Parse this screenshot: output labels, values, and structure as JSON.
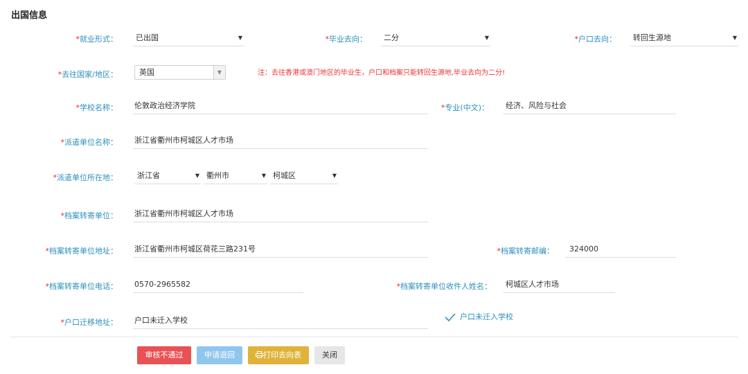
{
  "section_title": "出国信息",
  "fields": {
    "employment_form": {
      "label": "*就业形式：",
      "value": "已出国"
    },
    "graduation_destination": {
      "label": "*毕业去向：",
      "value": "二分"
    },
    "hukou_destination": {
      "label": "*户口去向：",
      "value": "转回生源地"
    },
    "country": {
      "label": "*去往国家/地区：",
      "value": "英国"
    },
    "notice": "注：去往香港或澳门地区的毕业生，户口和档案只能转回生源地,毕业去向为二分!",
    "school_name": {
      "label": "*学校名称：",
      "value": "伦敦政治经济学院"
    },
    "major": {
      "label": "*专业(中文)：",
      "value": "经济、风险与社会"
    },
    "dispatch_unit_name": {
      "label": "*派遣单位名称：",
      "value": "浙江省衢州市柯城区人才市场"
    },
    "dispatch_unit_location": {
      "label": "*派遣单位所在地：",
      "province": "浙江省",
      "city": "衢州市",
      "district": "柯城区"
    },
    "archive_unit": {
      "label": "*档案转寄单位：",
      "value": "浙江省衢州市柯城区人才市场"
    },
    "archive_address": {
      "label": "*档案转寄单位地址：",
      "value": "浙江省衢州市柯城区荷花三路231号"
    },
    "archive_postcode": {
      "label": "*档案转寄邮编：",
      "value": "324000"
    },
    "archive_phone": {
      "label": "*档案转寄单位电话：",
      "value": "0570-2965582"
    },
    "archive_recipient": {
      "label": "*档案转寄单位收件人姓名：",
      "value": "柯城区人才市场"
    },
    "hukou_address": {
      "label": "*户口迁移地址：",
      "value": "户口未迁入学校"
    },
    "hukou_not_moved": {
      "label": "户口未迁入学校"
    }
  },
  "buttons": {
    "reject": "审核不通过",
    "return": "申请退回",
    "print": "打印去向表",
    "close": "关闭"
  },
  "colors": {
    "label": "#2a8fbd",
    "notice": "#e33333",
    "reject_btn": "#e85254",
    "return_btn": "#8fc6ee",
    "print_btn": "#e0b23a",
    "close_btn": "#e6e6e6"
  }
}
